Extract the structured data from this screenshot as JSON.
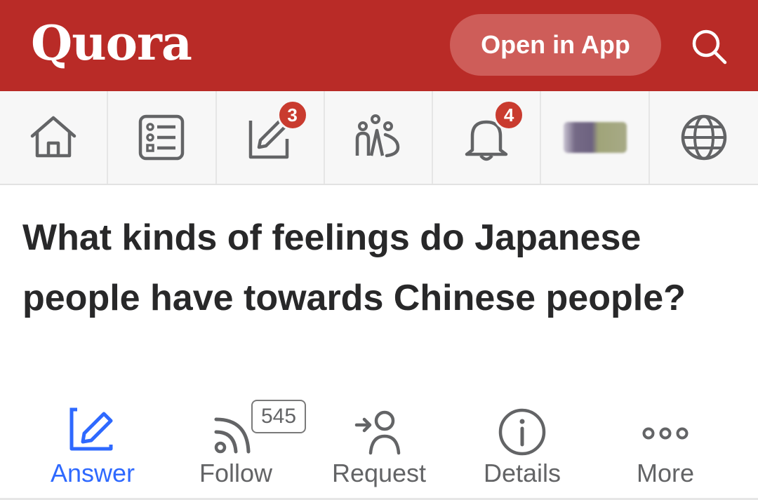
{
  "header": {
    "logo": "Quora",
    "open_app_label": "Open in App",
    "search_icon": "search-icon",
    "background": "#b92b27"
  },
  "nav": {
    "items": [
      {
        "icon": "home-icon"
      },
      {
        "icon": "answer-list-icon"
      },
      {
        "icon": "write-icon",
        "badge": "3"
      },
      {
        "icon": "spaces-icon"
      },
      {
        "icon": "bell-icon",
        "badge": "4"
      },
      {
        "icon": "avatar"
      },
      {
        "icon": "globe-icon"
      }
    ]
  },
  "question": {
    "title": "What kinds of feelings do Japanese people have towards Chinese people?"
  },
  "actions": {
    "answer_label": "Answer",
    "follow_label": "Follow",
    "follow_count": "545",
    "request_label": "Request",
    "details_label": "Details",
    "more_label": "More",
    "accent": "#2e69ff"
  }
}
